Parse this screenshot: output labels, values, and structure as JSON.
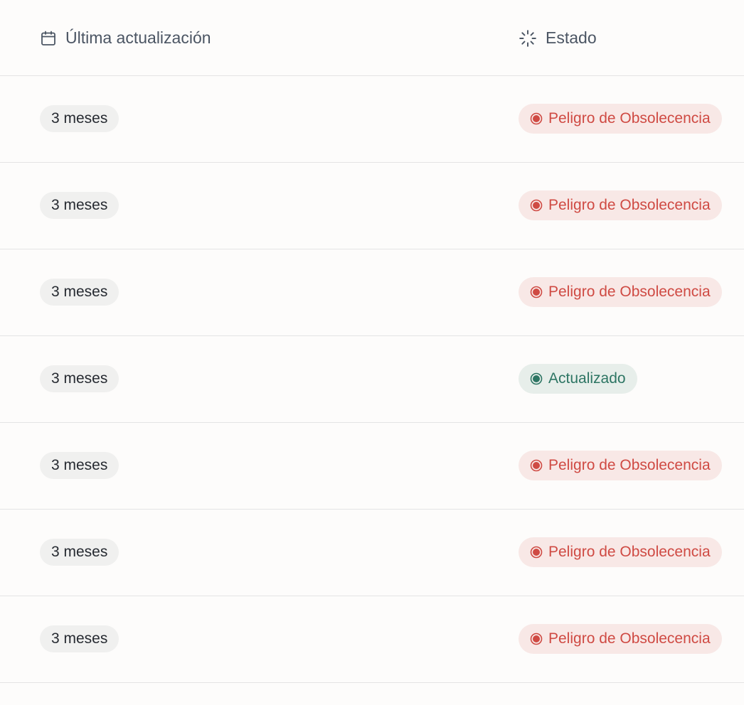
{
  "header": {
    "last_update_label": "Última actualización",
    "status_label": "Estado",
    "last_update_icon": "calendar-icon",
    "status_icon": "loader-icon"
  },
  "colors": {
    "danger_text": "#cf4a43",
    "danger_bg": "#f8e8e6",
    "ok_text": "#2d7563",
    "ok_bg": "#e7eeea"
  },
  "rows": [
    {
      "last_update": "3 meses",
      "status": "Peligro de Obsolecencia",
      "status_kind": "danger"
    },
    {
      "last_update": "3 meses",
      "status": "Peligro de Obsolecencia",
      "status_kind": "danger"
    },
    {
      "last_update": "3 meses",
      "status": "Peligro de Obsolecencia",
      "status_kind": "danger"
    },
    {
      "last_update": "3 meses",
      "status": "Actualizado",
      "status_kind": "ok"
    },
    {
      "last_update": "3 meses",
      "status": "Peligro de Obsolecencia",
      "status_kind": "danger"
    },
    {
      "last_update": "3 meses",
      "status": "Peligro de Obsolecencia",
      "status_kind": "danger"
    },
    {
      "last_update": "3 meses",
      "status": "Peligro de Obsolecencia",
      "status_kind": "danger"
    }
  ]
}
